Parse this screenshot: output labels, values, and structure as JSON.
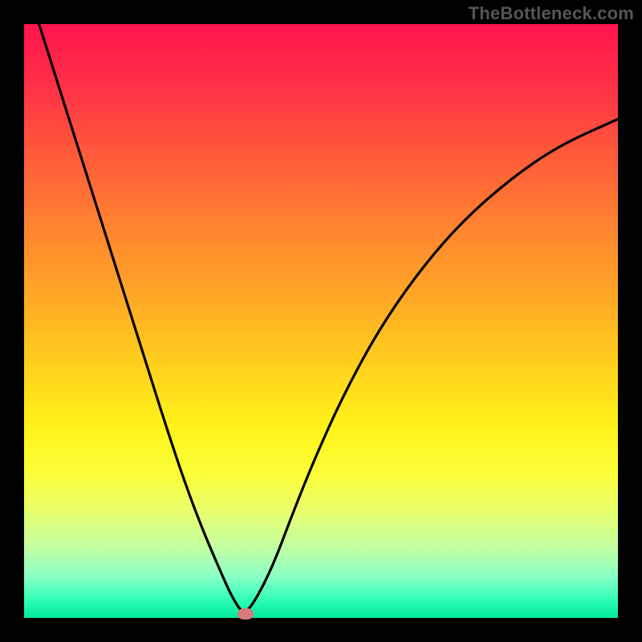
{
  "watermark": "TheBottleneck.com",
  "chart_data": {
    "type": "line",
    "title": "",
    "xlabel": "",
    "ylabel": "",
    "xlim": [
      0,
      100
    ],
    "ylim": [
      0,
      100
    ],
    "background_gradient_top_color": "#ff144d",
    "background_gradient_bottom_color": "#00e79a",
    "curve": {
      "description": "V-shaped bottleneck curve with minimum near x≈37",
      "x": [
        0,
        3,
        6,
        9,
        12,
        15,
        18,
        21,
        24,
        27,
        30,
        33,
        35,
        37,
        39,
        42,
        45,
        49,
        54,
        60,
        67,
        74,
        82,
        90,
        100
      ],
      "y": [
        108,
        98.5,
        89,
        79.5,
        70,
        60.5,
        51,
        41.5,
        32,
        23,
        15,
        8,
        3.5,
        0.5,
        3,
        9,
        17,
        27,
        38,
        49,
        59,
        67,
        74,
        79.5,
        84
      ]
    },
    "marker": {
      "x": 37.3,
      "y": 0.7,
      "color": "#d87a79"
    }
  }
}
